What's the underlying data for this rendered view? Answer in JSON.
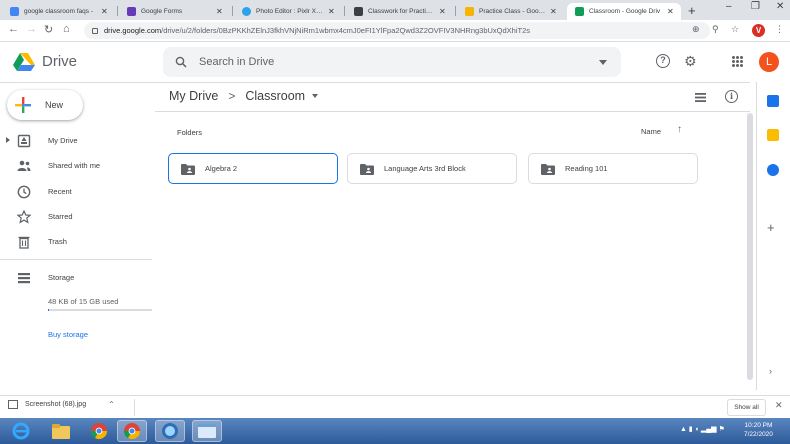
{
  "browser": {
    "tabs": [
      {
        "title": "google classroom faqs - ",
        "favicon_color": "#4285f4",
        "active": false
      },
      {
        "title": "Google Forms",
        "favicon_color": "#673ab7",
        "active": false
      },
      {
        "title": "Photo Editor : Pixlr X - fr",
        "favicon_color": "#2aa3e8",
        "active": false
      },
      {
        "title": "Classwork for Practice Cl",
        "favicon_color": "#3c4043",
        "active": false
      },
      {
        "title": "Practice Class - Google C",
        "favicon_color": "#f4b400",
        "active": false
      },
      {
        "title": "Classroom - Google Driv",
        "favicon_color": "#0f9d58",
        "active": true
      }
    ],
    "new_tab": "+",
    "window_controls": [
      "–",
      "❐",
      "✕"
    ],
    "url_host": "drive.google.com",
    "url_path": "/drive/u/2/folders/0BzPKKhZElnJ3fkhVNjNiRm1wbmx4cmJ0eFI1YlFpa2Qwd3Z2OVFIV3NHRng3bUxQdXhiT2s",
    "profile_initial": "V"
  },
  "drive": {
    "app_name": "Drive",
    "search_placeholder": "Search in Drive",
    "avatar_initial": "L"
  },
  "sidebar": {
    "new_label": "New",
    "items": [
      {
        "label": "My Drive",
        "icon": "my-drive-icon"
      },
      {
        "label": "Shared with me",
        "icon": "shared-icon"
      },
      {
        "label": "Recent",
        "icon": "clock-icon"
      },
      {
        "label": "Starred",
        "icon": "star-icon"
      },
      {
        "label": "Trash",
        "icon": "trash-icon"
      }
    ],
    "storage_label": "Storage",
    "storage_used": "48 KB of 15 GB used",
    "storage_fraction": 0.01,
    "buy_storage": "Buy storage"
  },
  "main": {
    "breadcrumb_root": "My Drive",
    "breadcrumb_sep": ">",
    "breadcrumb_current": "Classroom",
    "folders_label": "Folders",
    "sort_label": "Name",
    "folders": [
      {
        "name": "Algebra 2",
        "selected": true
      },
      {
        "name": "Language Arts 3rd Block",
        "selected": false
      },
      {
        "name": "Reading 101",
        "selected": false
      }
    ]
  },
  "downloads": {
    "file": "Screenshot (68).jpg",
    "show_all": "Show all"
  },
  "taskbar": {
    "time": "10:20 PM",
    "date": "7/22/2020"
  },
  "colors": {
    "accent": "#1a73e8",
    "selected_border": "#1a73e8",
    "avatar": "#f4511e"
  }
}
